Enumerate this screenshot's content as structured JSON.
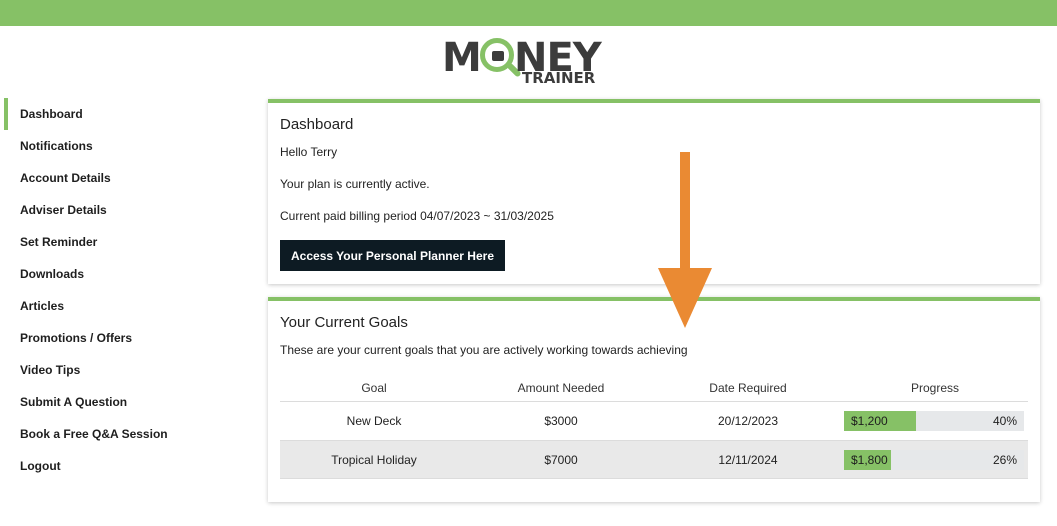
{
  "brand": {
    "logo_word_left": "M",
    "logo_word_right": "NEY",
    "logo_sub": "TRAINER",
    "accent_color": "#86c166",
    "button_color": "#0d1b23",
    "arrow_color": "#ea8a33"
  },
  "sidebar": {
    "items": [
      {
        "label": "Dashboard",
        "active": true
      },
      {
        "label": "Notifications"
      },
      {
        "label": "Account Details"
      },
      {
        "label": "Adviser Details"
      },
      {
        "label": "Set Reminder"
      },
      {
        "label": "Downloads"
      },
      {
        "label": "Articles"
      },
      {
        "label": "Promotions / Offers"
      },
      {
        "label": "Video Tips"
      },
      {
        "label": "Submit A Question"
      },
      {
        "label": "Book a Free Q&A Session"
      },
      {
        "label": "Logout"
      }
    ]
  },
  "dashboard": {
    "title": "Dashboard",
    "greeting": "Hello Terry",
    "plan_status": "Your plan is currently active.",
    "billing_period": "Current paid billing period 04/07/2023 ~ 31/03/2025",
    "planner_button": "Access Your Personal Planner Here"
  },
  "goals": {
    "title": "Your Current Goals",
    "subtitle": "These are your current goals that you are actively working towards achieving",
    "headers": {
      "goal": "Goal",
      "amount": "Amount Needed",
      "date": "Date Required",
      "progress": "Progress"
    },
    "rows": [
      {
        "goal": "New Deck",
        "amount": "$3000",
        "date": "20/12/2023",
        "saved": "$1,200",
        "percent_label": "40%",
        "percent": 40
      },
      {
        "goal": "Tropical Holiday",
        "amount": "$7000",
        "date": "12/11/2024",
        "saved": "$1,800",
        "percent_label": "26%",
        "percent": 26
      }
    ]
  },
  "annotation": {
    "arrow_icon": "down-arrow-icon"
  }
}
